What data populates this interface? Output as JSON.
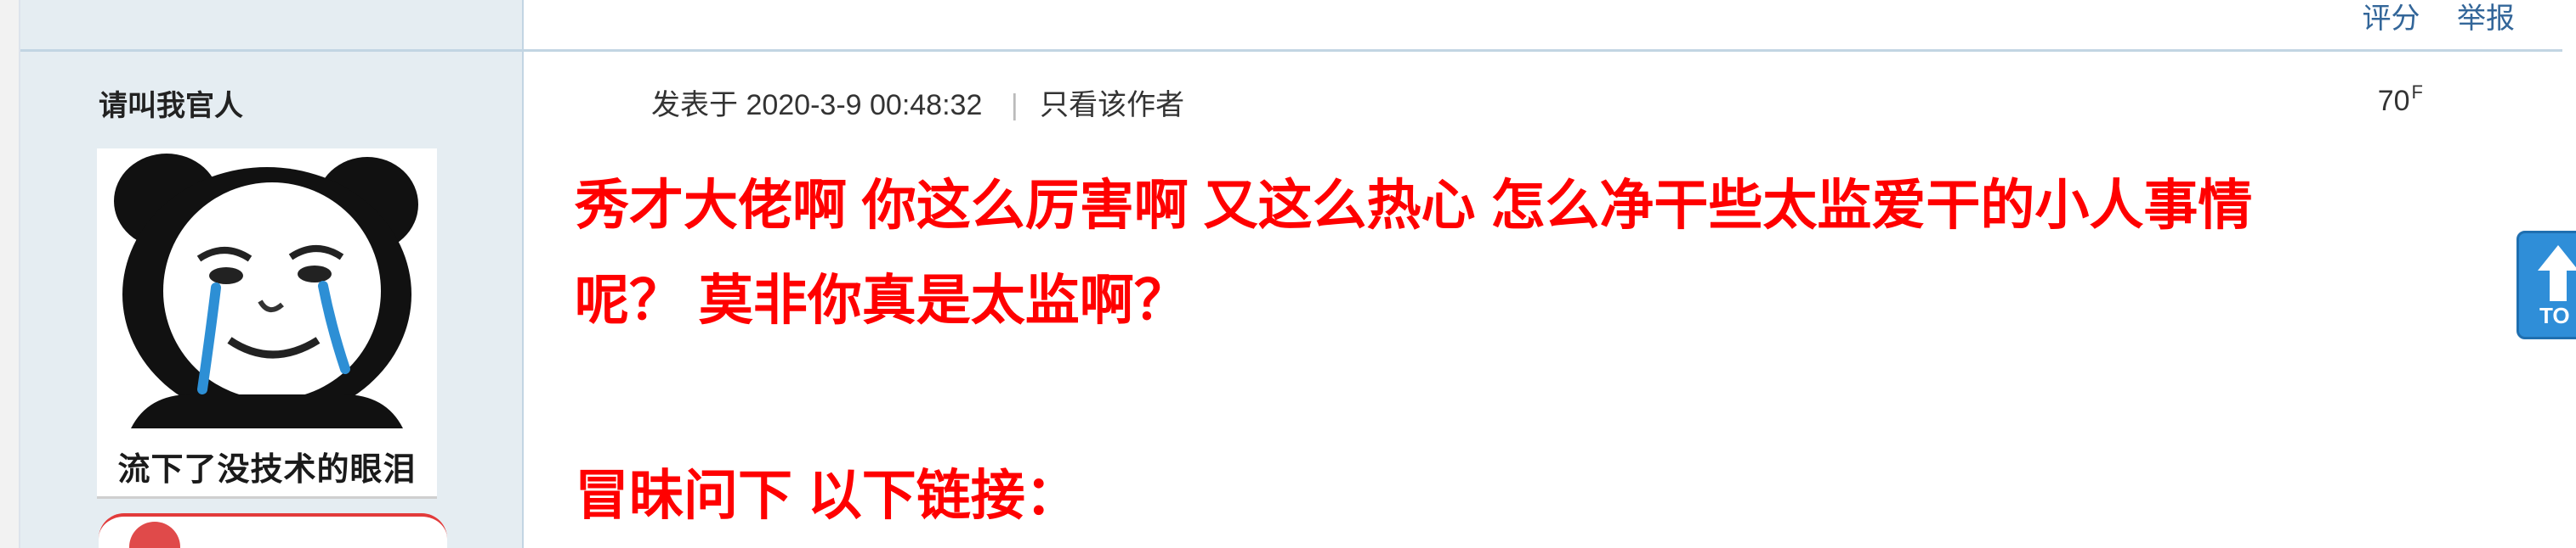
{
  "prev_post": {
    "actions": [
      {
        "label": "评分"
      },
      {
        "label": "举报"
      }
    ]
  },
  "post": {
    "author_name": "请叫我官人",
    "avatar_caption": "流下了没技术的眼泪",
    "meta_prefix": "发表于",
    "datetime": "2020-3-9 00:48:32",
    "meta_separator": "|",
    "only_author_label": "只看该作者",
    "floor_number": "70",
    "floor_suffix": "F",
    "body_lines": [
      "秀才大佬啊 你这么厉害啊 又这么热心  怎么净干些太监爱干的小人事情",
      "呢？ 莫非你真是太监啊？",
      "冒昧问下 以下链接："
    ]
  },
  "back_to_top": {
    "label": "TO",
    "icon": "arrow-up-icon"
  },
  "colors": {
    "post_text": "#ff0000",
    "link": "#336699",
    "sidebar_bg": "#e5edf2",
    "border": "#c2d5e3",
    "back_top_bg": "#2f8ed8"
  }
}
